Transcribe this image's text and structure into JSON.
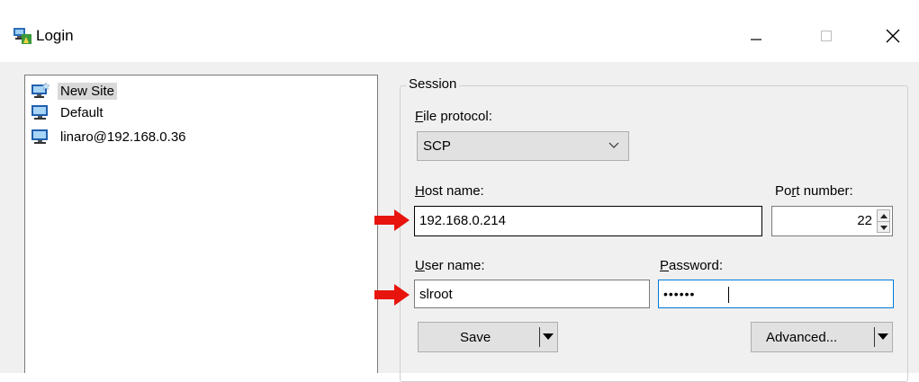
{
  "window": {
    "title": "Login"
  },
  "tree": {
    "items": [
      {
        "label": "New Site",
        "icon": "new-site-icon",
        "selected": true
      },
      {
        "label": "Default",
        "icon": "computer-icon",
        "selected": false
      },
      {
        "label": "linaro@192.168.0.36",
        "icon": "computer-icon",
        "selected": false
      }
    ]
  },
  "session": {
    "legend": "Session",
    "file_protocol": {
      "label_pre": "",
      "label_accel": "F",
      "label_post": "ile protocol:",
      "value": "SCP"
    },
    "host_name": {
      "label_accel": "H",
      "label_post": "ost name:",
      "value": "192.168.0.214"
    },
    "port_number": {
      "label_pre": "Po",
      "label_accel": "r",
      "label_post": "t number:",
      "value": "22"
    },
    "user_name": {
      "label_accel": "U",
      "label_post": "ser name:",
      "value": "slroot"
    },
    "password": {
      "label_accel": "P",
      "label_post": "assword:",
      "value": "••••••"
    }
  },
  "buttons": {
    "save_label": "Save",
    "advanced_label": "Advanced..."
  },
  "colors": {
    "arrow": "#e8140e",
    "focus_border": "#0078d7",
    "selected_bg": "#d9d9d9"
  }
}
